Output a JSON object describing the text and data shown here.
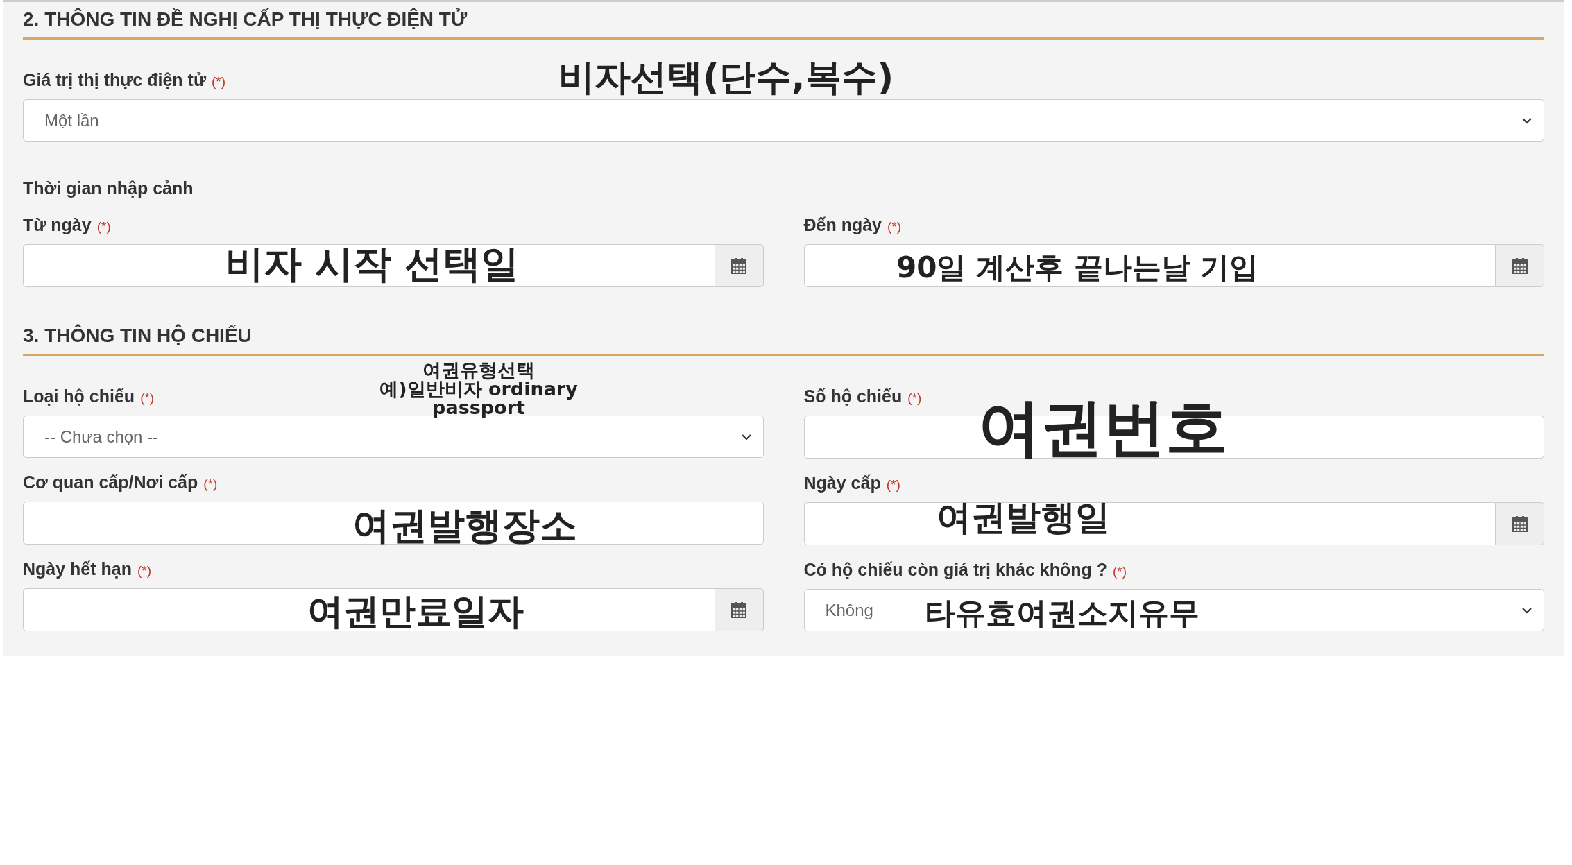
{
  "sections": [
    {
      "title": "2. THÔNG TIN ĐỀ NGHỊ CẤP THỊ THỰC ĐIỆN TỬ",
      "blocks": [
        {
          "kind": "field",
          "field": {
            "label": "Giá trị thị thực điện tử",
            "required_mark": "(*)",
            "kind": "select",
            "value": "Một lần",
            "annotation": "비자선택(단수,복수)"
          }
        },
        {
          "kind": "subheading",
          "text": "Thời gian nhập cảnh"
        },
        {
          "kind": "columns",
          "columns": [
            [
              {
                "label": "Từ ngày",
                "required_mark": "(*)",
                "kind": "date",
                "annotation": "비자 시작 선택일"
              }
            ],
            [
              {
                "label": "Đến ngày",
                "required_mark": "(*)",
                "kind": "date",
                "annotation": "90일 계산후 끝나는날 기입"
              }
            ]
          ]
        }
      ]
    },
    {
      "title": "3. THÔNG TIN HỘ CHIẾU",
      "blocks": [
        {
          "kind": "columns",
          "columns": [
            [
              {
                "label": "Loại hộ chiếu",
                "required_mark": "(*)",
                "kind": "select",
                "placeholder": "-- Chưa chọn --",
                "annotation": "여권유형선택\n예)일반비자 ordinary passport"
              },
              {
                "label": "Cơ quan cấp/Nơi cấp",
                "required_mark": "(*)",
                "kind": "text",
                "annotation": "여권발행장소"
              },
              {
                "label": "Ngày hết hạn",
                "required_mark": "(*)",
                "kind": "date",
                "annotation": "여권만료일자"
              }
            ],
            [
              {
                "label": "Số hộ chiếu",
                "required_mark": "(*)",
                "kind": "text",
                "annotation": "여권번호"
              },
              {
                "label": "Ngày cấp",
                "required_mark": "(*)",
                "kind": "date",
                "annotation": "여권발행일"
              },
              {
                "label": "Có hộ chiếu còn giá trị khác không ?",
                "required_mark": "(*)",
                "kind": "select",
                "value": "Không",
                "annotation": "타유효여권소지유무"
              }
            ]
          ]
        }
      ]
    }
  ]
}
